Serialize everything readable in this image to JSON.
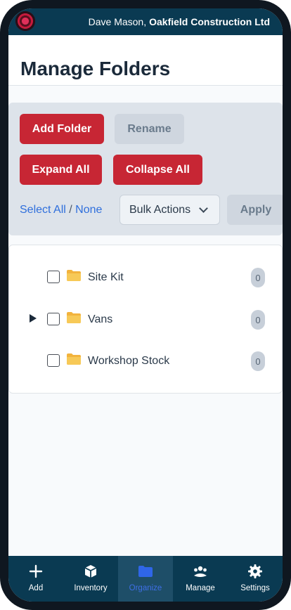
{
  "header": {
    "user_name": "Dave Mason,",
    "company": "Oakfield Construction Ltd"
  },
  "page": {
    "title": "Manage Folders"
  },
  "toolbar": {
    "add_folder": "Add Folder",
    "rename": "Rename",
    "expand_all": "Expand All",
    "collapse_all": "Collapse All",
    "select_all": "Select All",
    "separator": "/",
    "none": "None",
    "bulk_actions": "Bulk Actions",
    "apply": "Apply"
  },
  "folders": [
    {
      "name": "Site Kit",
      "count": "0",
      "has_children": false
    },
    {
      "name": "Vans",
      "count": "0",
      "has_children": true
    },
    {
      "name": "Workshop Stock",
      "count": "0",
      "has_children": false
    }
  ],
  "nav": [
    {
      "label": "Add",
      "icon": "plus-icon"
    },
    {
      "label": "Inventory",
      "icon": "box-icon"
    },
    {
      "label": "Organize",
      "icon": "folder-icon",
      "active": true
    },
    {
      "label": "Manage",
      "icon": "people-icon"
    },
    {
      "label": "Settings",
      "icon": "gear-icon"
    }
  ],
  "colors": {
    "brand": "#0a3a52",
    "primary_button": "#c72634",
    "link": "#2f6fdc",
    "active_nav": "#3e6fe6"
  }
}
